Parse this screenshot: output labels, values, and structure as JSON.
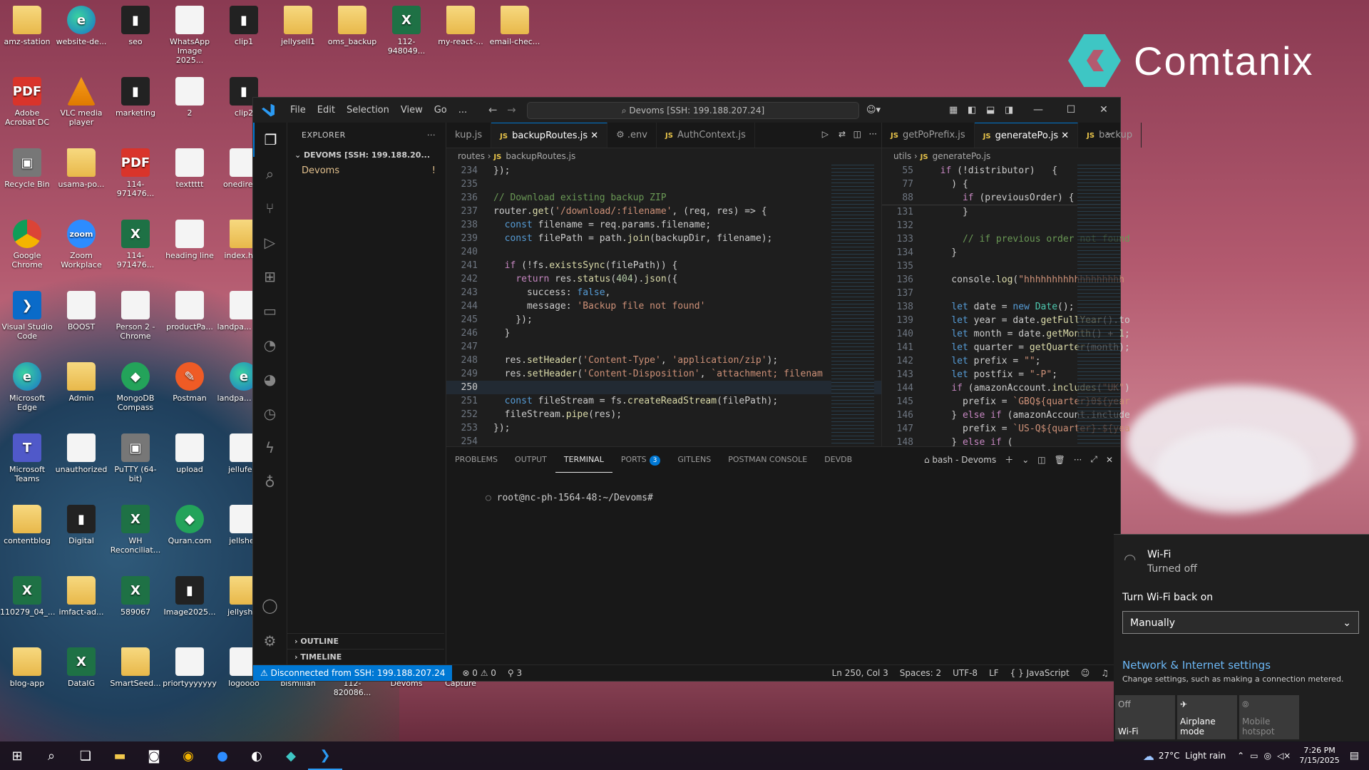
{
  "brand": {
    "name": "Comtanix"
  },
  "desktop_icons": [
    {
      "label": "amz-station",
      "kind": "folder",
      "col": 0,
      "row": 0
    },
    {
      "label": "website-de...",
      "kind": "edge",
      "col": 1,
      "row": 0
    },
    {
      "label": "seo",
      "kind": "dark",
      "col": 2,
      "row": 0
    },
    {
      "label": "WhatsApp Image 2025...",
      "kind": "doc",
      "col": 3,
      "row": 0
    },
    {
      "label": "clip1",
      "kind": "dark",
      "col": 4,
      "row": 0
    },
    {
      "label": "jellysell1",
      "kind": "folder",
      "col": 5,
      "row": 0
    },
    {
      "label": "oms_backup",
      "kind": "folder",
      "col": 6,
      "row": 0
    },
    {
      "label": "112-948049...",
      "kind": "excel",
      "col": 7,
      "row": 0
    },
    {
      "label": "my-react-...",
      "kind": "folder",
      "col": 8,
      "row": 0
    },
    {
      "label": "email-chec...",
      "kind": "folder",
      "col": 9,
      "row": 0
    },
    {
      "label": "Adobe Acrobat DC",
      "kind": "pdf",
      "col": 0,
      "row": 1
    },
    {
      "label": "VLC media player",
      "kind": "vlc",
      "col": 1,
      "row": 1
    },
    {
      "label": "marketing",
      "kind": "dark",
      "col": 2,
      "row": 1
    },
    {
      "label": "2",
      "kind": "doc",
      "col": 3,
      "row": 1
    },
    {
      "label": "clip2",
      "kind": "dark",
      "col": 4,
      "row": 1
    },
    {
      "label": "Recycle Bin",
      "kind": "gray",
      "col": 0,
      "row": 2
    },
    {
      "label": "usama-po...",
      "kind": "folder",
      "col": 1,
      "row": 2
    },
    {
      "label": "114-971476...",
      "kind": "pdf",
      "col": 2,
      "row": 2
    },
    {
      "label": "texttttt",
      "kind": "doc",
      "col": 3,
      "row": 2
    },
    {
      "label": "onedirec...",
      "kind": "doc",
      "col": 4,
      "row": 2
    },
    {
      "label": "Google Chrome",
      "kind": "chrome",
      "col": 0,
      "row": 3
    },
    {
      "label": "Zoom Workplace",
      "kind": "zoom",
      "col": 1,
      "row": 3
    },
    {
      "label": "114-971476...",
      "kind": "excel",
      "col": 2,
      "row": 3
    },
    {
      "label": "heading line",
      "kind": "doc",
      "col": 3,
      "row": 3
    },
    {
      "label": "index.ht...",
      "kind": "folder",
      "col": 4,
      "row": 3
    },
    {
      "label": "Visual Studio Code",
      "kind": "vscode",
      "col": 0,
      "row": 4
    },
    {
      "label": "BOOST",
      "kind": "doc",
      "col": 1,
      "row": 4
    },
    {
      "label": "Person 2 - Chrome",
      "kind": "doc",
      "col": 2,
      "row": 4
    },
    {
      "label": "productPa...",
      "kind": "doc",
      "col": 3,
      "row": 4
    },
    {
      "label": "landpa... logo",
      "kind": "doc",
      "col": 4,
      "row": 4
    },
    {
      "label": "Microsoft Edge",
      "kind": "edge",
      "col": 0,
      "row": 5
    },
    {
      "label": "Admin",
      "kind": "folder",
      "col": 1,
      "row": 5
    },
    {
      "label": "MongoDB Compass",
      "kind": "green",
      "col": 2,
      "row": 5
    },
    {
      "label": "Postman",
      "kind": "orange",
      "col": 3,
      "row": 5
    },
    {
      "label": "landpa... logo",
      "kind": "edge",
      "col": 4,
      "row": 5
    },
    {
      "label": "Microsoft Teams",
      "kind": "teams",
      "col": 0,
      "row": 6
    },
    {
      "label": "unauthorized",
      "kind": "doc",
      "col": 1,
      "row": 6
    },
    {
      "label": "PuTTY (64-bit)",
      "kind": "gray",
      "col": 2,
      "row": 6
    },
    {
      "label": "upload",
      "kind": "doc",
      "col": 3,
      "row": 6
    },
    {
      "label": "jellufe...",
      "kind": "doc",
      "col": 4,
      "row": 6
    },
    {
      "label": "contentblog",
      "kind": "folder",
      "col": 0,
      "row": 7
    },
    {
      "label": "Digital",
      "kind": "dark",
      "col": 1,
      "row": 7
    },
    {
      "label": "WH Reconciliat...",
      "kind": "excel",
      "col": 2,
      "row": 7
    },
    {
      "label": "Quran.com",
      "kind": "green",
      "col": 3,
      "row": 7
    },
    {
      "label": "jellshell",
      "kind": "doc",
      "col": 4,
      "row": 7
    },
    {
      "label": "110279_04_...",
      "kind": "excel",
      "col": 0,
      "row": 8
    },
    {
      "label": "imfact-ad...",
      "kind": "folder",
      "col": 1,
      "row": 8
    },
    {
      "label": "589067",
      "kind": "excel",
      "col": 2,
      "row": 8
    },
    {
      "label": "Image2025...",
      "kind": "dark",
      "col": 3,
      "row": 8
    },
    {
      "label": "jellysh...",
      "kind": "folder",
      "col": 4,
      "row": 8
    },
    {
      "label": "blog-app",
      "kind": "folder",
      "col": 0,
      "row": 9
    },
    {
      "label": "DataIG",
      "kind": "excel",
      "col": 1,
      "row": 9
    },
    {
      "label": "SmartSeed...",
      "kind": "folder",
      "col": 2,
      "row": 9
    },
    {
      "label": "priortyyyyyyy",
      "kind": "doc",
      "col": 3,
      "row": 9
    },
    {
      "label": "logoooo",
      "kind": "doc",
      "col": 4,
      "row": 9
    },
    {
      "label": "bismillah",
      "kind": "doc",
      "col": 5,
      "row": 9
    },
    {
      "label": "112-820086...",
      "kind": "doc",
      "col": 6,
      "row": 9
    },
    {
      "label": "Devoms",
      "kind": "folder",
      "col": 7,
      "row": 9
    },
    {
      "label": "Capture",
      "kind": "doc",
      "col": 8,
      "row": 9
    }
  ],
  "vscode": {
    "menu": [
      "File",
      "Edit",
      "Selection",
      "View",
      "Go",
      "..."
    ],
    "command_center": "Devoms [SSH: 199.188.207.24]",
    "explorer": {
      "title": "EXPLORER",
      "root": "DEVOMS [SSH: 199.188.20...",
      "item": "Devoms",
      "item_badge": "!",
      "outline": "OUTLINE",
      "timeline": "TIMELINE"
    },
    "left_tabs": [
      {
        "label": "kup.js",
        "active": false,
        "js": false
      },
      {
        "label": "backupRoutes.js",
        "active": true,
        "js": true
      },
      {
        "label": ".env",
        "active": false,
        "js": false
      },
      {
        "label": "AuthContext.js",
        "active": false,
        "js": true
      }
    ],
    "right_tabs": [
      {
        "label": "getPoPrefix.js",
        "active": false,
        "js": true
      },
      {
        "label": "generatePo.js",
        "active": true,
        "js": true
      },
      {
        "label": "backup",
        "active": false,
        "js": true
      }
    ],
    "left_breadcrumb": [
      "routes",
      "backupRoutes.js"
    ],
    "right_breadcrumb": [
      "utils",
      "generatePo.js"
    ],
    "left_code": [
      {
        "n": "234",
        "t": "});"
      },
      {
        "n": "235",
        "t": ""
      },
      {
        "n": "236",
        "t": "// Download existing backup ZIP"
      },
      {
        "n": "237",
        "t": "router.get('/download/:filename', (req, res) => {"
      },
      {
        "n": "238",
        "t": "  const filename = req.params.filename;"
      },
      {
        "n": "239",
        "t": "  const filePath = path.join(backupDir, filename);"
      },
      {
        "n": "240",
        "t": ""
      },
      {
        "n": "241",
        "t": "  if (!fs.existsSync(filePath)) {"
      },
      {
        "n": "242",
        "t": "    return res.status(404).json({"
      },
      {
        "n": "243",
        "t": "      success: false,"
      },
      {
        "n": "244",
        "t": "      message: 'Backup file not found'"
      },
      {
        "n": "245",
        "t": "    });"
      },
      {
        "n": "246",
        "t": "  }"
      },
      {
        "n": "247",
        "t": ""
      },
      {
        "n": "248",
        "t": "  res.setHeader('Content-Type', 'application/zip');"
      },
      {
        "n": "249",
        "t": "  res.setHeader('Content-Disposition', `attachment; filenam"
      },
      {
        "n": "250",
        "t": ""
      },
      {
        "n": "251",
        "t": "  const fileStream = fs.createReadStream(filePath);"
      },
      {
        "n": "252",
        "t": "  fileStream.pipe(res);"
      },
      {
        "n": "253",
        "t": "});"
      },
      {
        "n": "254",
        "t": ""
      }
    ],
    "right_sticky": [
      {
        "n": "55",
        "t": "  if (!distributor)   {"
      },
      {
        "n": "77",
        "t": "    ) {"
      },
      {
        "n": "88",
        "t": "      if (previousOrder) {"
      }
    ],
    "right_code": [
      {
        "n": "131",
        "t": "      }"
      },
      {
        "n": "132",
        "t": ""
      },
      {
        "n": "133",
        "t": "      // if previous order not found"
      },
      {
        "n": "134",
        "t": "    }"
      },
      {
        "n": "135",
        "t": ""
      },
      {
        "n": "136",
        "t": "    console.log(\"hhhhhhhhhhhhhhhhhh"
      },
      {
        "n": "137",
        "t": ""
      },
      {
        "n": "138",
        "t": "    let date = new Date();"
      },
      {
        "n": "139",
        "t": "    let year = date.getFullYear().to"
      },
      {
        "n": "140",
        "t": "    let month = date.getMonth() + 1;"
      },
      {
        "n": "141",
        "t": "    let quarter = getQuarter(month);"
      },
      {
        "n": "142",
        "t": "    let prefix = \"\";"
      },
      {
        "n": "143",
        "t": "    let postfix = \"-P\";"
      },
      {
        "n": "144",
        "t": "    if (amazonAccount.includes(\"UK\")"
      },
      {
        "n": "145",
        "t": "      prefix = `GBQ${quarter}0${year"
      },
      {
        "n": "146",
        "t": "    } else if (amazonAccount.include"
      },
      {
        "n": "147",
        "t": "      prefix = `US-Q${quarter}-${yea"
      },
      {
        "n": "148",
        "t": "    } else if ("
      }
    ],
    "panel_tabs": [
      {
        "label": "PROBLEMS",
        "active": false
      },
      {
        "label": "OUTPUT",
        "active": false
      },
      {
        "label": "TERMINAL",
        "active": true
      },
      {
        "label": "PORTS",
        "active": false,
        "badge": "3"
      },
      {
        "label": "GITLENS",
        "active": false
      },
      {
        "label": "POSTMAN CONSOLE",
        "active": false
      },
      {
        "label": "DEVDB",
        "active": false
      }
    ],
    "terminal_name": "bash - Devoms",
    "terminal_prompt": "root@nc-ph-1564-48:~/Devoms#",
    "status": {
      "remote": "Disconnected from SSH: 199.188.207.24",
      "errors": "0",
      "warnings": "0",
      "ports": "3",
      "position": "Ln 250, Col 3",
      "spaces": "Spaces: 2",
      "encoding": "UTF-8",
      "eol": "LF",
      "language": "JavaScript"
    }
  },
  "wifi_flyout": {
    "title": "Wi-Fi",
    "state": "Turned off",
    "turn_back_label": "Turn Wi-Fi back on",
    "select_value": "Manually",
    "settings_link": "Network & Internet settings",
    "settings_sub": "Change settings, such as making a connection metered.",
    "tiles": [
      {
        "state": "Off",
        "label": "Wi-Fi"
      },
      {
        "state": "",
        "label": "Airplane mode"
      },
      {
        "state": "",
        "label": "Mobile hotspot"
      }
    ]
  },
  "taskbar": {
    "weather": "27°C  Light rain",
    "time": "7:26 PM",
    "date": "7/15/2025"
  },
  "colors": {
    "accent": "#0078d4",
    "brand": "#3ec6c4"
  }
}
